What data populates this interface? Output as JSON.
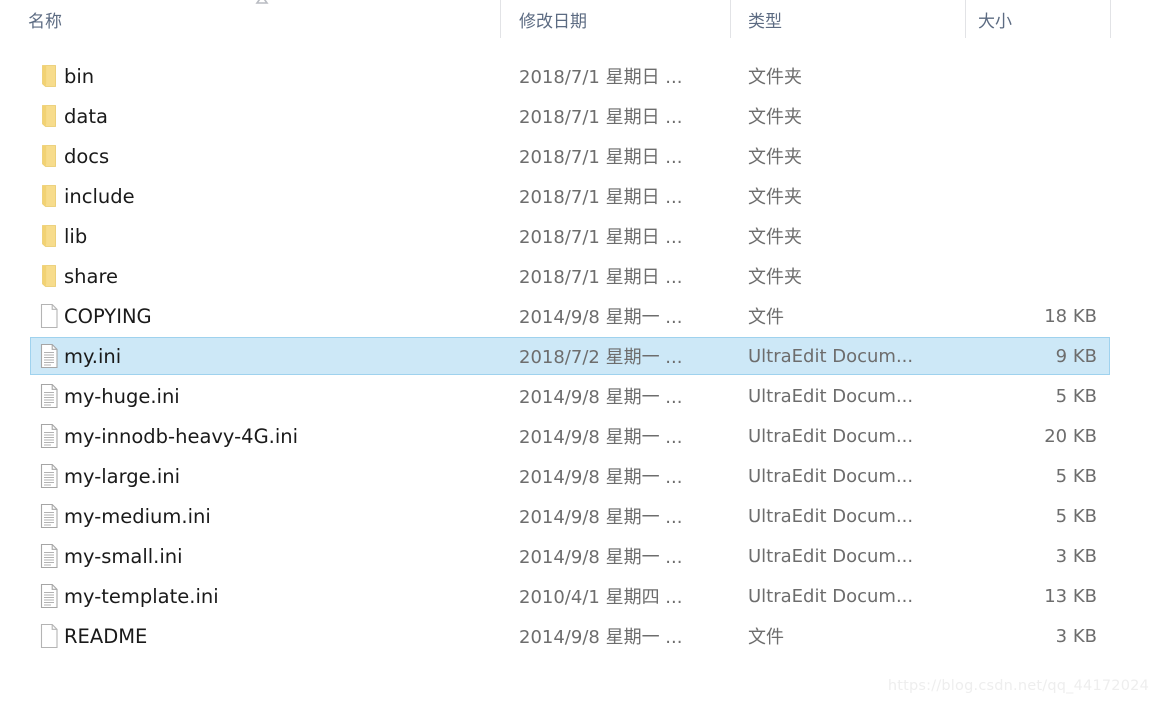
{
  "window": {
    "app": "windows-file-explorer",
    "view_mode": "details"
  },
  "columns": {
    "name": "名称",
    "date_modified": "修改日期",
    "type": "类型",
    "size": "大小"
  },
  "sort": {
    "column": "名称",
    "direction": "ascending",
    "indicator_icon": "sort-ascending-arrow"
  },
  "colors": {
    "selection_fill": "#cde8f7",
    "selection_border": "#9fd2ee",
    "header_text": "#5c6b82",
    "folder_icon": "#f5d87f",
    "secondary_text": "#6d6d6d",
    "primary_text": "#1a1a1a",
    "divider": "#e2e3e6"
  },
  "rows": [
    {
      "name": "bin",
      "date": "2018/7/1 星期日 ...",
      "type": "文件夹",
      "size": "",
      "icon": "folder-icon",
      "selected": false
    },
    {
      "name": "data",
      "date": "2018/7/1 星期日 ...",
      "type": "文件夹",
      "size": "",
      "icon": "folder-icon",
      "selected": false
    },
    {
      "name": "docs",
      "date": "2018/7/1 星期日 ...",
      "type": "文件夹",
      "size": "",
      "icon": "folder-icon",
      "selected": false
    },
    {
      "name": "include",
      "date": "2018/7/1 星期日 ...",
      "type": "文件夹",
      "size": "",
      "icon": "folder-icon",
      "selected": false
    },
    {
      "name": "lib",
      "date": "2018/7/1 星期日 ...",
      "type": "文件夹",
      "size": "",
      "icon": "folder-icon",
      "selected": false
    },
    {
      "name": "share",
      "date": "2018/7/1 星期日 ...",
      "type": "文件夹",
      "size": "",
      "icon": "folder-icon",
      "selected": false
    },
    {
      "name": "COPYING",
      "date": "2014/9/8 星期一 ...",
      "type": "文件",
      "size": "18 KB",
      "icon": "blank-document-icon",
      "selected": false
    },
    {
      "name": "my.ini",
      "date": "2018/7/2 星期一 ...",
      "type": "UltraEdit Docum...",
      "size": "9 KB",
      "icon": "text-document-icon",
      "selected": true
    },
    {
      "name": "my-huge.ini",
      "date": "2014/9/8 星期一 ...",
      "type": "UltraEdit Docum...",
      "size": "5 KB",
      "icon": "text-document-icon",
      "selected": false
    },
    {
      "name": "my-innodb-heavy-4G.ini",
      "date": "2014/9/8 星期一 ...",
      "type": "UltraEdit Docum...",
      "size": "20 KB",
      "icon": "text-document-icon",
      "selected": false
    },
    {
      "name": "my-large.ini",
      "date": "2014/9/8 星期一 ...",
      "type": "UltraEdit Docum...",
      "size": "5 KB",
      "icon": "text-document-icon",
      "selected": false
    },
    {
      "name": "my-medium.ini",
      "date": "2014/9/8 星期一 ...",
      "type": "UltraEdit Docum...",
      "size": "5 KB",
      "icon": "text-document-icon",
      "selected": false
    },
    {
      "name": "my-small.ini",
      "date": "2014/9/8 星期一 ...",
      "type": "UltraEdit Docum...",
      "size": "3 KB",
      "icon": "text-document-icon",
      "selected": false
    },
    {
      "name": "my-template.ini",
      "date": "2010/4/1 星期四 ...",
      "type": "UltraEdit Docum...",
      "size": "13 KB",
      "icon": "text-document-icon",
      "selected": false
    },
    {
      "name": "README",
      "date": "2014/9/8 星期一 ...",
      "type": "文件",
      "size": "3 KB",
      "icon": "blank-document-icon",
      "selected": false
    }
  ],
  "watermark": {
    "text": "https://blog.csdn.net/qq_44172024"
  }
}
